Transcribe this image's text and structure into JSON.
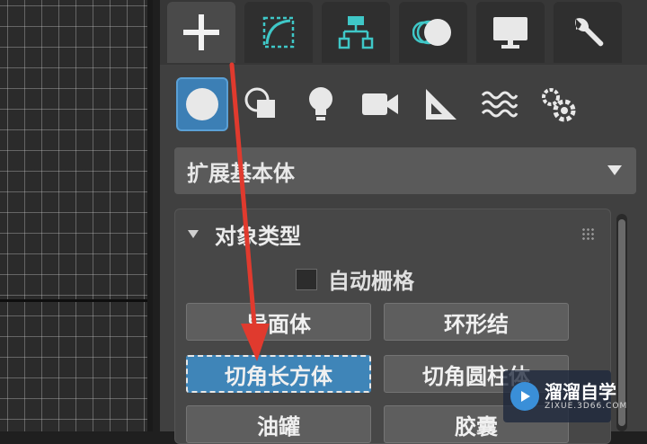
{
  "tabs": [
    {
      "name": "create",
      "icon": "plus-icon",
      "active": true
    },
    {
      "name": "modify",
      "icon": "modify-curve-icon"
    },
    {
      "name": "hierarchy",
      "icon": "hierarchy-icon"
    },
    {
      "name": "motion",
      "icon": "motion-icon"
    },
    {
      "name": "display",
      "icon": "monitor-icon"
    },
    {
      "name": "utilities",
      "icon": "wrench-icon"
    }
  ],
  "categories": [
    {
      "name": "geometry",
      "icon": "sphere-icon",
      "active": true
    },
    {
      "name": "shapes",
      "icon": "shapes-icon"
    },
    {
      "name": "lights",
      "icon": "lightbulb-icon"
    },
    {
      "name": "cameras",
      "icon": "camera-icon"
    },
    {
      "name": "helpers",
      "icon": "ruler-triangle-icon"
    },
    {
      "name": "space-warps",
      "icon": "waves-icon"
    },
    {
      "name": "systems",
      "icon": "gears-icon"
    }
  ],
  "dropdown": {
    "selected": "扩展基本体"
  },
  "rollout": {
    "title": "对象类型",
    "autogrid_label": "自动栅格",
    "buttons": [
      "异面体",
      "环形结",
      "切角长方体",
      "切角圆柱体",
      "油罐",
      "胶囊"
    ],
    "selected_index": 2
  },
  "watermark": {
    "title": "溜溜自学",
    "url": "ZIXUE.3D66.COM"
  },
  "colors": {
    "accent": "#3f85b8",
    "annotation": "#e03a2e"
  }
}
